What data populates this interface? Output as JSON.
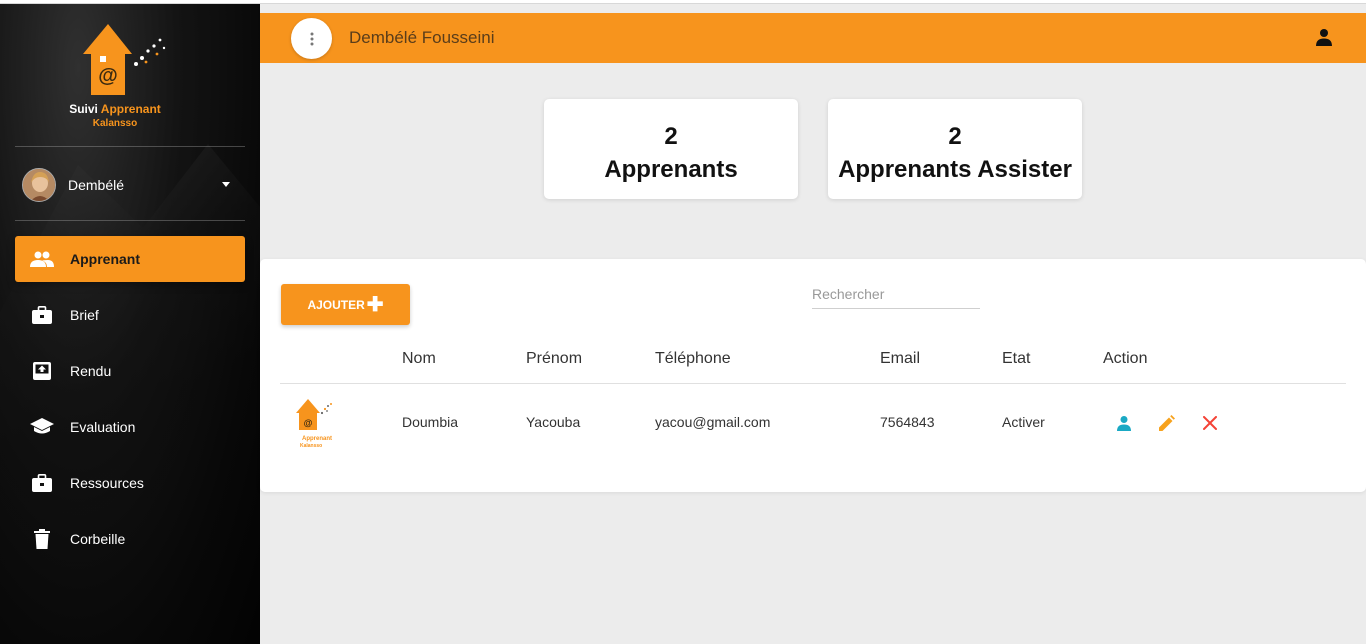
{
  "brand": {
    "name_part1": "Suivi",
    "name_part2": "Apprenant",
    "subtitle": "Kalansso",
    "accent_color": "#f7941d"
  },
  "user": {
    "name": "Dembélé"
  },
  "sidebar": {
    "items": [
      {
        "label": "Apprenant",
        "icon": "people-icon",
        "active": true
      },
      {
        "label": "Brief",
        "icon": "briefcase-icon",
        "active": false
      },
      {
        "label": "Rendu",
        "icon": "inbox-upload-icon",
        "active": false
      },
      {
        "label": "Evaluation",
        "icon": "school-icon",
        "active": false
      },
      {
        "label": "Ressources",
        "icon": "briefcase-icon",
        "active": false
      },
      {
        "label": "Corbeille",
        "icon": "trash-icon",
        "active": false
      }
    ]
  },
  "header": {
    "title": "Dembélé Fousseini"
  },
  "stats": [
    {
      "value": "2",
      "label": "Apprenants"
    },
    {
      "value": "2",
      "label": "Apprenants Assister"
    }
  ],
  "toolbar": {
    "add_label": "AJOUTER",
    "search_placeholder": "Rechercher"
  },
  "table": {
    "columns": [
      "Nom",
      "Prénom",
      "Téléphone",
      "Email",
      "Etat",
      "Action"
    ],
    "rows": [
      {
        "logo_text": "Apprenant",
        "logo_sub": "Kalansso",
        "nom": "Doumbia",
        "prenom": "Yacouba",
        "telephone": "yacou@gmail.com",
        "email": "7564843",
        "etat": "Activer"
      }
    ]
  }
}
